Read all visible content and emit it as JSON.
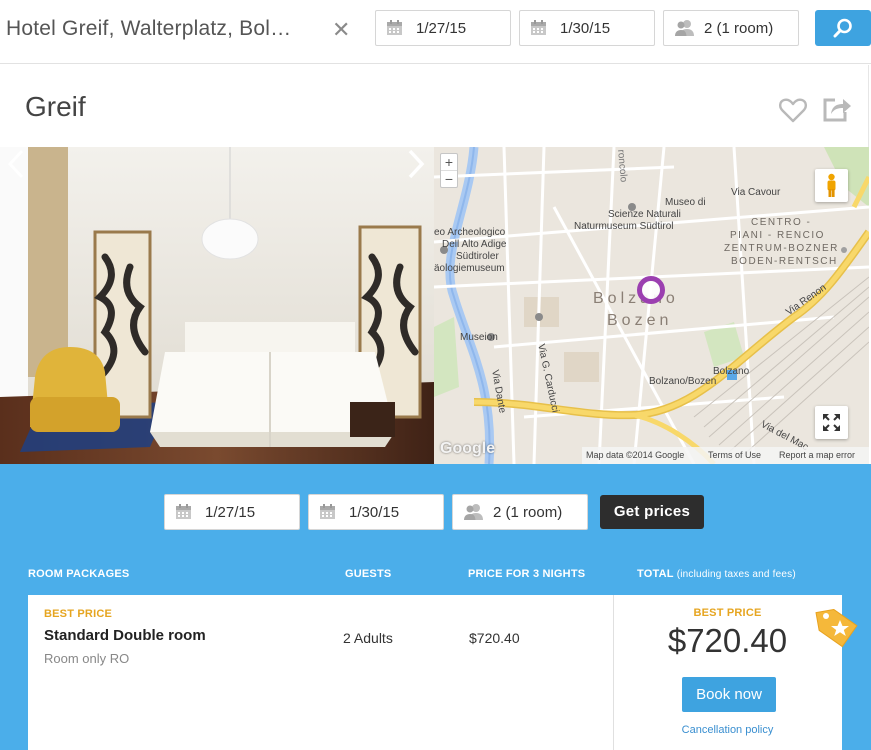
{
  "search": {
    "query": "Hotel Greif, Walterplatz, Bol…",
    "clear_icon": "close-icon",
    "checkin": "1/27/15",
    "checkout": "1/30/15",
    "guests": "2 (1 room)",
    "search_icon": "search-icon"
  },
  "hotel": {
    "name": "Greif",
    "favorite_icon": "heart-icon",
    "share_icon": "share-icon"
  },
  "map": {
    "zoom_in": "+",
    "zoom_out": "−",
    "labels": {
      "museo_di": "Museo di",
      "scienze": "Scienze Naturali",
      "naturmuseum": "Naturmuseum Südtirol",
      "via_cavour": "Via Cavour",
      "archeologico": "eo Archeologico",
      "alto_adige": "Dell Alto Adige",
      "sudtiroler": "Südtiroler",
      "aologiemuseum": "äologiemuseum",
      "centro": "CENTRO -",
      "piani": "PIANI - RENCIO",
      "zentrum": "ZENTRUM-BOZNER",
      "boden": "BODEN-RENTSCH",
      "bolzano": "Bolzano",
      "bozen": "Bozen",
      "museion": "Museion",
      "via_dante": "Via Dante",
      "via_carducci": "Via G. Carducci",
      "via_renon": "Via Renon",
      "station_1": "Bolzano",
      "station_2": "Bolzano/Bozen",
      "via_del_macello": "Via del Mac",
      "roncolo": "roncolo"
    },
    "google": "Google",
    "map_data": "Map data ©2014 Google",
    "terms": "Terms of Use",
    "report": "Report a map error"
  },
  "booking": {
    "checkin": "1/27/15",
    "checkout": "1/30/15",
    "guests": "2 (1 room)",
    "get_prices": "Get prices",
    "columns": {
      "room_packages": "ROOM PACKAGES",
      "guests": "GUESTS",
      "price": "PRICE FOR 3 NIGHTS",
      "total": "TOTAL",
      "total_sub": "(including taxes and fees)"
    },
    "offer": {
      "best_price_label": "BEST PRICE",
      "room_name": "Standard Double room",
      "room_type": "Room only RO",
      "guests": "2 Adults",
      "price": "$720.40",
      "total_best_label": "BEST PRICE",
      "total": "$720.40",
      "book_now": "Book now",
      "cancellation": "Cancellation policy"
    }
  },
  "colors": {
    "accent": "#3ea3e0",
    "panel": "#4baeea",
    "best_price": "#e6a520",
    "marker": "#9b3fb0"
  }
}
